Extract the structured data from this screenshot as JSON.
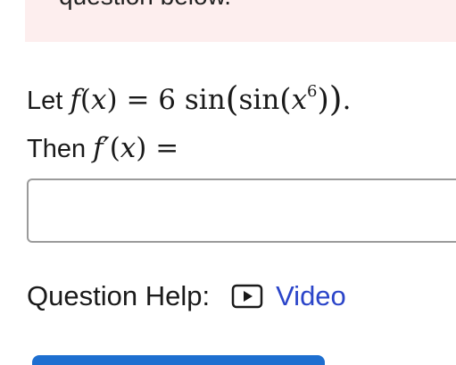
{
  "instructions": {
    "text": "question below."
  },
  "problem": {
    "let_label": "Let",
    "function_name": "f",
    "variable": "x",
    "equals": "=",
    "coefficient": "6",
    "outer_func": "sin",
    "inner_func": "sin",
    "exponent": "6",
    "period": ".",
    "then_label": "Then",
    "derivative_name": "f′",
    "paren_open": "(",
    "paren_close": ")"
  },
  "answer": {
    "value": "",
    "placeholder": ""
  },
  "help": {
    "label": "Question Help:",
    "video_label": "Video",
    "video_icon": "play-icon"
  },
  "colors": {
    "instructions_bg": "#fdeeee",
    "link": "#2b45c9",
    "input_border": "#9b9b9b",
    "submit_button": "#1e6fd0"
  }
}
